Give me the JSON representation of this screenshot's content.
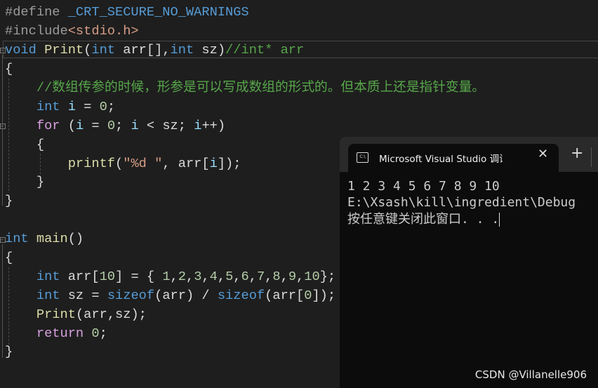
{
  "editor": {
    "lines": [
      [
        [
          "#define ",
          "pp"
        ],
        [
          "_CRT_SECURE_NO_WARNINGS",
          "kw"
        ]
      ],
      [
        [
          "#include",
          "pp"
        ],
        [
          "<stdio.h>",
          "inc"
        ]
      ],
      [
        [
          "void ",
          "kw"
        ],
        [
          "Print",
          "fn"
        ],
        [
          "(",
          "tx"
        ],
        [
          "int ",
          "kw"
        ],
        [
          "arr",
          "tx"
        ],
        [
          "[],",
          "tx"
        ],
        [
          "int ",
          "kw"
        ],
        [
          "sz",
          "tx"
        ],
        [
          ")",
          "tx"
        ],
        [
          "//int* arr",
          "cm"
        ]
      ],
      [
        [
          "{",
          "tx"
        ]
      ],
      [
        [
          "    ",
          "tx"
        ],
        [
          "//数组传参的时候，形参是可以写成数组的形式的。但本质上还是指针变量。",
          "cm"
        ]
      ],
      [
        [
          "    ",
          "tx"
        ],
        [
          "int ",
          "kw"
        ],
        [
          "i",
          "var"
        ],
        [
          " = ",
          "tx"
        ],
        [
          "0",
          "num"
        ],
        [
          ";",
          "tx"
        ]
      ],
      [
        [
          "    ",
          "tx"
        ],
        [
          "for ",
          "ctl"
        ],
        [
          "(",
          "tx"
        ],
        [
          "i",
          "var"
        ],
        [
          " = ",
          "tx"
        ],
        [
          "0",
          "num"
        ],
        [
          "; ",
          "tx"
        ],
        [
          "i",
          "var"
        ],
        [
          " < ",
          "tx"
        ],
        [
          "sz",
          "tx"
        ],
        [
          "; ",
          "tx"
        ],
        [
          "i",
          "var"
        ],
        [
          "++)",
          "tx"
        ]
      ],
      [
        [
          "    {",
          "tx"
        ]
      ],
      [
        [
          "        ",
          "tx"
        ],
        [
          "printf",
          "fn"
        ],
        [
          "(",
          "tx"
        ],
        [
          "\"%d \"",
          "str"
        ],
        [
          ", ",
          "tx"
        ],
        [
          "arr",
          "tx"
        ],
        [
          "[",
          "tx"
        ],
        [
          "i",
          "var"
        ],
        [
          "]);",
          "tx"
        ]
      ],
      [
        [
          "    }",
          "tx"
        ]
      ],
      [
        [
          "}",
          "tx"
        ]
      ],
      [],
      [
        [
          "int ",
          "kw"
        ],
        [
          "main",
          "fn"
        ],
        [
          "()",
          "tx"
        ]
      ],
      [
        [
          "{",
          "tx"
        ]
      ],
      [
        [
          "    ",
          "tx"
        ],
        [
          "int ",
          "kw"
        ],
        [
          "arr",
          "tx"
        ],
        [
          "[",
          "tx"
        ],
        [
          "10",
          "num"
        ],
        [
          "] = { ",
          "tx"
        ],
        [
          "1",
          "num"
        ],
        [
          ",",
          "tx"
        ],
        [
          "2",
          "num"
        ],
        [
          ",",
          "tx"
        ],
        [
          "3",
          "num"
        ],
        [
          ",",
          "tx"
        ],
        [
          "4",
          "num"
        ],
        [
          ",",
          "tx"
        ],
        [
          "5",
          "num"
        ],
        [
          ",",
          "tx"
        ],
        [
          "6",
          "num"
        ],
        [
          ",",
          "tx"
        ],
        [
          "7",
          "num"
        ],
        [
          ",",
          "tx"
        ],
        [
          "8",
          "num"
        ],
        [
          ",",
          "tx"
        ],
        [
          "9",
          "num"
        ],
        [
          ",",
          "tx"
        ],
        [
          "10",
          "num"
        ],
        [
          "};",
          "tx"
        ]
      ],
      [
        [
          "    ",
          "tx"
        ],
        [
          "int ",
          "kw"
        ],
        [
          "sz",
          "tx"
        ],
        [
          " = ",
          "tx"
        ],
        [
          "sizeof",
          "kw"
        ],
        [
          "(",
          "tx"
        ],
        [
          "arr",
          "tx"
        ],
        [
          ") / ",
          "tx"
        ],
        [
          "sizeof",
          "kw"
        ],
        [
          "(",
          "tx"
        ],
        [
          "arr",
          "tx"
        ],
        [
          "[",
          "tx"
        ],
        [
          "0",
          "num"
        ],
        [
          "]);",
          "tx"
        ]
      ],
      [
        [
          "    ",
          "tx"
        ],
        [
          "Print",
          "fn"
        ],
        [
          "(",
          "tx"
        ],
        [
          "arr",
          "tx"
        ],
        [
          ",",
          "tx"
        ],
        [
          "sz",
          "tx"
        ],
        [
          ");",
          "tx"
        ]
      ],
      [
        [
          "    ",
          "tx"
        ],
        [
          "return ",
          "ctl"
        ],
        [
          "0",
          "num"
        ],
        [
          ";",
          "tx"
        ]
      ],
      [
        [
          "}",
          "tx"
        ]
      ]
    ]
  },
  "console": {
    "tab_title": "Microsoft Visual Studio 调试控制台",
    "tab_icon": "terminal-icon",
    "close_icon": "close-icon",
    "new_tab_icon": "plus-icon",
    "icon_text": "C:\\",
    "output": [
      "1 2 3 4 5 6 7 8 9 10",
      "E:\\Xsash\\kill\\ingredient\\Debug",
      "按任意键关闭此窗口. . ."
    ]
  },
  "watermark": "CSDN @Villanelle906"
}
